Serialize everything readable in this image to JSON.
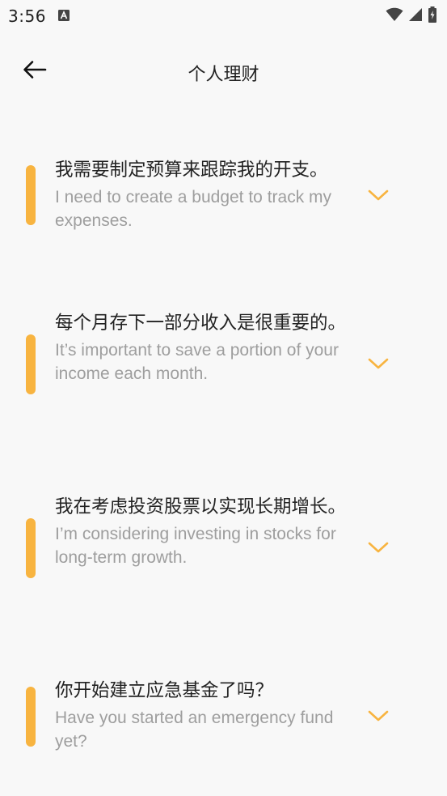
{
  "status_bar": {
    "time": "3:56",
    "icons": [
      "notification-a-icon",
      "wifi-icon",
      "signal-icon",
      "battery-icon"
    ]
  },
  "app_bar": {
    "title": "个人理财",
    "back_icon": "arrow-left-icon"
  },
  "colors": {
    "accent": "#f8b440",
    "chevron": "#f8b440",
    "primary_text": "#222222",
    "secondary_text": "#9e9e9e",
    "background": "#f8f8f8"
  },
  "phrases": [
    {
      "chinese": "我需要制定预算来跟踪我的开支。",
      "english": "I need to create a budget to track my expenses.",
      "chevron_icon": "chevron-down-icon"
    },
    {
      "chinese": "每个月存下一部分收入是很重要的。",
      "english": "It’s important to save a portion of your income each month.",
      "chevron_icon": "chevron-down-icon"
    },
    {
      "chinese": "我在考虑投资股票以实现长期增长。",
      "english": "I’m considering investing in stocks for long-term growth.",
      "chevron_icon": "chevron-down-icon"
    },
    {
      "chinese": "你开始建立应急基金了吗？",
      "english": "Have you started an emergency fund yet?",
      "chevron_icon": "chevron-down-icon"
    }
  ]
}
